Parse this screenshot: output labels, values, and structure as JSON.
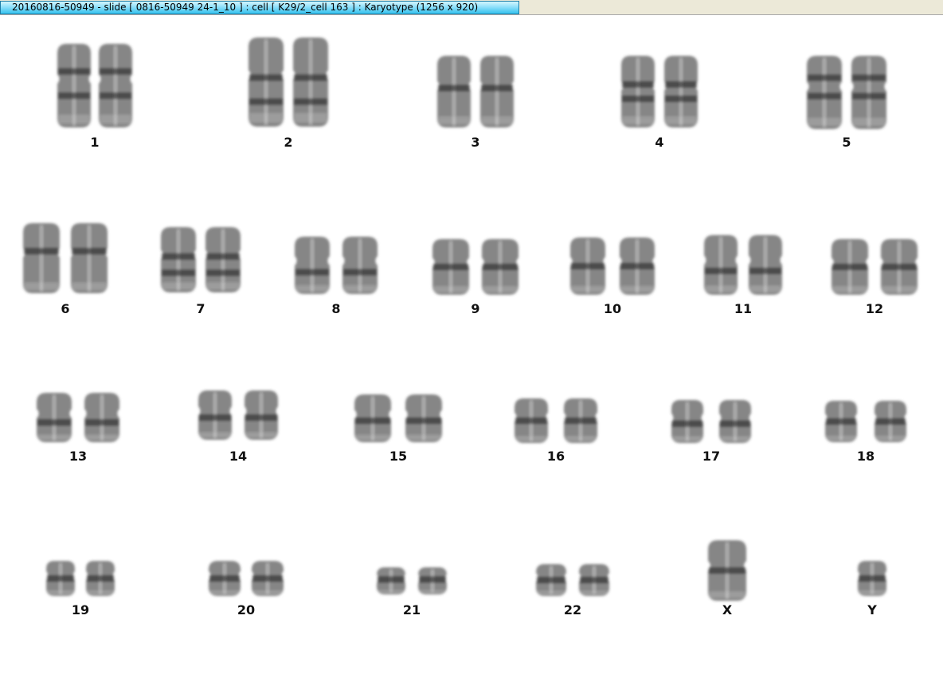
{
  "window": {
    "title": "20160816-50949 - slide [ 0816-50949 24-1_10 ] : cell [ K29/2_cell 163 ] : Karyotype  (1256 x 920)"
  },
  "colors": {
    "tab_accent": "#35c2ee",
    "chromosome_stain": "#3c3c3c",
    "band_dark": "#1a1a1a",
    "background": "#ffffff"
  },
  "karyotype": {
    "slots": [
      {
        "label": "1"
      },
      {
        "label": "2"
      },
      {
        "label": "3"
      },
      {
        "label": "4"
      },
      {
        "label": "5"
      },
      {
        "label": "6"
      },
      {
        "label": "7"
      },
      {
        "label": "8"
      },
      {
        "label": "9"
      },
      {
        "label": "10"
      },
      {
        "label": "11"
      },
      {
        "label": "12"
      },
      {
        "label": "13"
      },
      {
        "label": "14"
      },
      {
        "label": "15"
      },
      {
        "label": "16"
      },
      {
        "label": "17"
      },
      {
        "label": "18"
      },
      {
        "label": "19"
      },
      {
        "label": "20"
      },
      {
        "label": "21"
      },
      {
        "label": "22"
      },
      {
        "label": "X"
      },
      {
        "label": "Y"
      }
    ]
  }
}
